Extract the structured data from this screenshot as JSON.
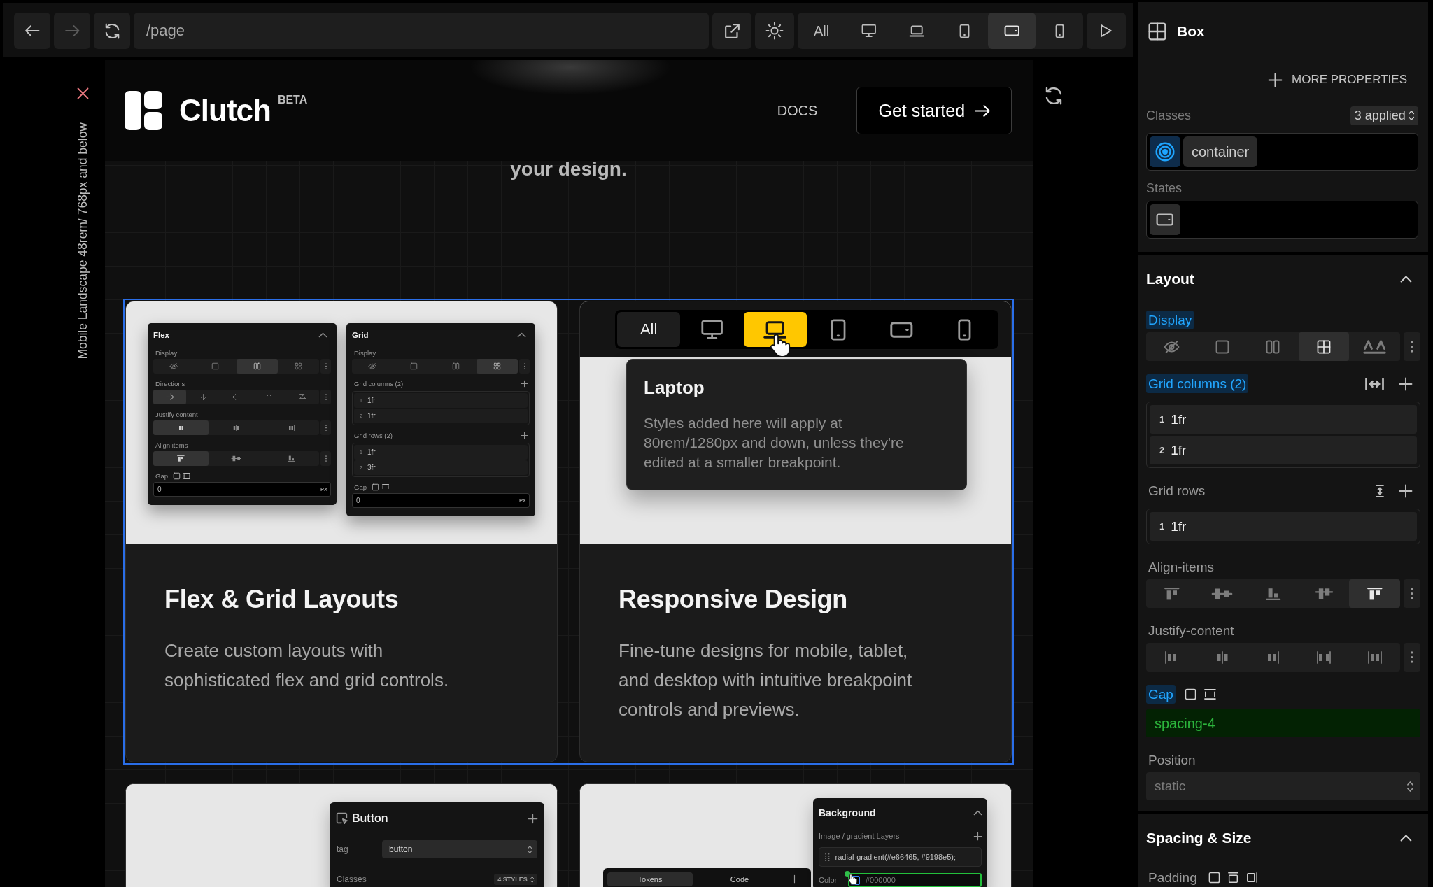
{
  "toolbar": {
    "nav": [
      {
        "kind": "back",
        "disabled": false
      },
      {
        "kind": "forward",
        "disabled": true
      },
      {
        "kind": "reload",
        "disabled": false
      }
    ],
    "url": "/page",
    "devices": [
      {
        "kind": "all",
        "label": "All",
        "selected": false
      },
      {
        "kind": "desktop",
        "selected": false
      },
      {
        "kind": "laptop",
        "selected": false
      },
      {
        "kind": "tablet",
        "selected": false
      },
      {
        "kind": "tablet-landscape",
        "selected": true
      },
      {
        "kind": "mobile",
        "selected": false
      }
    ]
  },
  "canvas": {
    "breakpoint": "Mobile Landscape 48rem/ 768px and below",
    "site": {
      "brand": "Clutch",
      "badge": "BETA",
      "nav": [
        "DOCS"
      ],
      "cta": "Get started",
      "heading": "your design.",
      "features": [
        {
          "kind": "flex-grid",
          "title": "Flex & Grid Layouts",
          "description": "Create custom layouts with sophisticated flex and grid controls.",
          "panels": [
            {
              "title": "Flex",
              "expanded": true,
              "rows": [
                {
                  "kind": "segmented",
                  "label": "Display",
                  "options": [
                    {
                      "kind": "display-hidden",
                      "selected": false
                    },
                    {
                      "kind": "display-block",
                      "selected": false
                    },
                    {
                      "kind": "display-flex",
                      "selected": true
                    },
                    {
                      "kind": "display-grid",
                      "selected": false
                    }
                  ]
                },
                {
                  "kind": "segmented",
                  "label": "Directions",
                  "options": [
                    {
                      "kind": "direction-row",
                      "selected": true
                    },
                    {
                      "kind": "direction-column",
                      "selected": false
                    },
                    {
                      "kind": "direction-row-reverse",
                      "selected": false
                    },
                    {
                      "kind": "direction-column-reverse",
                      "selected": false
                    },
                    {
                      "kind": "direction-wrap",
                      "selected": false
                    }
                  ]
                },
                {
                  "kind": "segmented",
                  "label": "Justify content",
                  "options": [
                    {
                      "kind": "justify-start",
                      "selected": true
                    },
                    {
                      "kind": "justify-center",
                      "selected": false
                    },
                    {
                      "kind": "justify-end",
                      "selected": false
                    }
                  ]
                },
                {
                  "kind": "segmented",
                  "label": "Align items",
                  "options": [
                    {
                      "kind": "align-start",
                      "selected": true
                    },
                    {
                      "kind": "align-center",
                      "selected": false
                    },
                    {
                      "kind": "align-end",
                      "selected": false
                    }
                  ]
                },
                {
                  "kind": "input",
                  "label": "Gap",
                  "value": "0",
                  "unit": "PX"
                }
              ]
            },
            {
              "title": "Grid",
              "expanded": true,
              "rows": [
                {
                  "kind": "segmented",
                  "label": "Display",
                  "options": [
                    {
                      "kind": "display-hidden",
                      "selected": false
                    },
                    {
                      "kind": "display-block",
                      "selected": false
                    },
                    {
                      "kind": "display-flex",
                      "selected": false
                    },
                    {
                      "kind": "display-grid",
                      "selected": true
                    }
                  ]
                },
                {
                  "kind": "column-tracks",
                  "label": "Grid columns (2)",
                  "tracks": [
                    {
                      "index": "1",
                      "value": "1fr"
                    },
                    {
                      "index": "2",
                      "value": "1fr"
                    }
                  ]
                },
                {
                  "kind": "row-tracks",
                  "label": "Grid rows (2)",
                  "tracks": [
                    {
                      "index": "1",
                      "value": "1fr"
                    },
                    {
                      "index": "2",
                      "value": "3fr"
                    }
                  ]
                },
                {
                  "kind": "input",
                  "label": "Gap",
                  "value": "0",
                  "unit": "PX"
                }
              ]
            }
          ]
        },
        {
          "kind": "responsive",
          "title": "Responsive Design",
          "description": "Fine-tune designs for mobile, tablet, and desktop with intuitive breakpoint controls and previews.",
          "devices": [
            {
              "kind": "all",
              "label": "All",
              "selected": false
            },
            {
              "kind": "desktop",
              "selected": false
            },
            {
              "kind": "laptop",
              "selected": true
            },
            {
              "kind": "tablet",
              "selected": false
            },
            {
              "kind": "tablet-landscape",
              "selected": false
            },
            {
              "kind": "mobile",
              "selected": false
            }
          ],
          "tooltip": {
            "title": "Laptop",
            "text": "Styles added here will apply at 80rem/1280px and down, unless they're edited at a smaller breakpoint."
          }
        },
        {
          "kind": "button-panel",
          "panel": {
            "title": "Button",
            "fields": [
              {
                "label": "tag",
                "value": "button"
              }
            ],
            "classes_label": "Classes",
            "classes_count": "4 STYLES"
          }
        },
        {
          "kind": "background-panel",
          "panel": {
            "title": "Background",
            "expanded": true,
            "layers_label": "Image / gradient Layers",
            "layers": [
              "radial-gradient(#e66465, #9198e5);"
            ],
            "color_label": "Color",
            "color_value": "#000000"
          },
          "tabs": [
            {
              "label": "Tokens",
              "selected": true
            },
            {
              "label": "Code",
              "selected": false
            }
          ]
        }
      ]
    }
  },
  "inspector": {
    "element": "Box",
    "add_property": "MORE PROPERTIES",
    "classes": {
      "label": "Classes",
      "count": "3 applied",
      "items": [
        "container"
      ]
    },
    "states": {
      "label": "States"
    },
    "sections": [
      {
        "title": "Layout",
        "expanded": true,
        "rows": [
          {
            "kind": "segmented",
            "label": "Display",
            "set": true,
            "options": [
              {
                "kind": "display-hidden",
                "selected": false
              },
              {
                "kind": "display-block",
                "selected": false
              },
              {
                "kind": "display-flex",
                "selected": false
              },
              {
                "kind": "display-grid",
                "selected": true
              },
              {
                "kind": "display-text",
                "selected": false
              }
            ]
          },
          {
            "kind": "column-tracks",
            "label": "Grid columns (2)",
            "set": true,
            "tracks": [
              {
                "index": "1",
                "value": "1fr"
              },
              {
                "index": "2",
                "value": "1fr"
              }
            ]
          },
          {
            "kind": "row-tracks",
            "label": "Grid rows",
            "set": false,
            "tracks": [
              {
                "index": "1",
                "value": "1fr"
              }
            ]
          },
          {
            "kind": "segmented",
            "label": "Align-items",
            "set": false,
            "options": [
              {
                "kind": "align-start",
                "selected": false
              },
              {
                "kind": "align-center",
                "selected": false
              },
              {
                "kind": "align-end",
                "selected": false
              },
              {
                "kind": "align-stretch",
                "selected": false
              },
              {
                "kind": "align-normal",
                "selected": true
              }
            ]
          },
          {
            "kind": "segmented",
            "label": "Justify-content",
            "set": false,
            "options": [
              {
                "kind": "justify-start",
                "selected": false
              },
              {
                "kind": "justify-center",
                "selected": false
              },
              {
                "kind": "justify-end",
                "selected": false
              },
              {
                "kind": "justify-between",
                "selected": false
              },
              {
                "kind": "justify-around",
                "selected": false
              }
            ]
          },
          {
            "kind": "token",
            "label": "Gap",
            "set": true,
            "value": "spacing-4"
          },
          {
            "kind": "select",
            "label": "Position",
            "set": false,
            "value": "static"
          }
        ]
      },
      {
        "title": "Spacing & Size",
        "expanded": true,
        "rows": [
          {
            "kind": "sides",
            "label": "Padding",
            "set": false
          }
        ]
      }
    ]
  }
}
